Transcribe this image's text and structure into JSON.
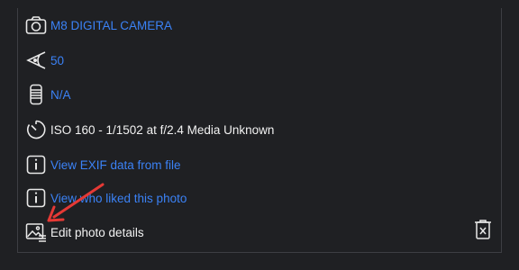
{
  "details": {
    "camera": {
      "label": "M8 DIGITAL CAMERA",
      "icon": "camera-icon"
    },
    "focal_length": {
      "label": "50",
      "icon": "focal-length-icon"
    },
    "lens": {
      "label": "N/A",
      "icon": "lens-icon"
    },
    "exposure": {
      "label": "ISO 160 - 1/1502 at f/2.4 Media Unknown",
      "icon": "timer-icon"
    },
    "exif_link": {
      "label": "View EXIF data from file",
      "icon": "info-icon"
    },
    "likes_link": {
      "label": "View who liked this photo",
      "icon": "info-icon"
    },
    "edit": {
      "label": "Edit photo details",
      "icon": "edit-image-icon"
    }
  },
  "actions": {
    "delete_icon": "trash-icon"
  },
  "colors": {
    "background": "#1f2023",
    "link": "#3b82f6",
    "text": "#f2f2f2",
    "annotation_arrow": "#e53935"
  }
}
